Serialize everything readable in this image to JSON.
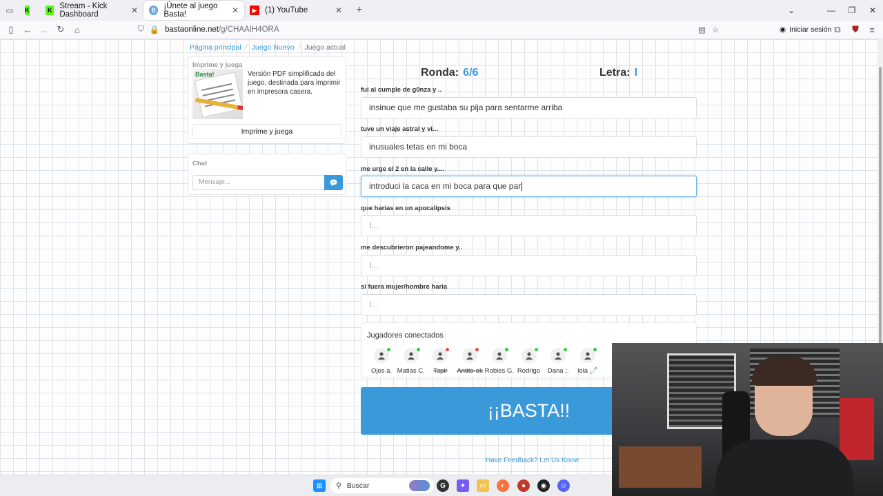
{
  "browser": {
    "tabs": [
      {
        "title": "",
        "favicon": "kick-icon",
        "color": "#53fc18"
      },
      {
        "title": "Stream - Kick Dashboard",
        "favicon": "kick-icon",
        "color": "#53fc18"
      },
      {
        "title": "¡Únete al juego Basta!",
        "favicon": "basta-icon",
        "color": "#6aa5e0"
      },
      {
        "title": "(1) YouTube",
        "favicon": "youtube-icon",
        "color": "#ff0000"
      }
    ],
    "url_host": "bastaonline.net",
    "url_path": "/g/CHAAIH4ORA",
    "signin_label": "Iniciar sesión"
  },
  "breadcrumb": {
    "home": "Página principal",
    "new_game": "Juego Nuevo",
    "current": "Juego actual"
  },
  "print_panel": {
    "title": "Imprime y juega",
    "description": "Versión PDF simplificada del juego, destinada para imprimir en impresora casera.",
    "thumb_brand": "Basta!",
    "button_label": "Imprime y juega"
  },
  "chat": {
    "title": "Chat",
    "placeholder": "Mensaje..."
  },
  "game": {
    "round_label": "Ronda:",
    "round_value": "6/6",
    "letter_label": "Letra:",
    "letter_value": "I"
  },
  "questions": [
    {
      "label": "fui al cumple de g0nza y ..",
      "value": "insinue que me gustaba su pija para sentarme arriba",
      "placeholder": ""
    },
    {
      "label": "tuve un viaje astral y vi...",
      "value": "inusuales tetas en mi boca",
      "placeholder": ""
    },
    {
      "label": "me urge el 2 en la calle y....",
      "value": "introduci la caca en mi boca para que par",
      "placeholder": ""
    },
    {
      "label": "que harias en un apocalipsis",
      "value": "",
      "placeholder": "I..."
    },
    {
      "label": "me descubrieron pajeandome y..",
      "value": "",
      "placeholder": "I..."
    },
    {
      "label": "si fuera mujer/hombre haria",
      "value": "",
      "placeholder": "I..."
    }
  ],
  "players_panel": {
    "title": "Jugadores conectados",
    "players": [
      {
        "name": "Ojos a.",
        "status_color": "#2ecc40",
        "strike": false
      },
      {
        "name": "Matias C.",
        "status_color": "#2ecc40",
        "strike": false
      },
      {
        "name": "Tapir",
        "status_color": "#e74c3c",
        "strike": true
      },
      {
        "name": "Antito-ok",
        "status_color": "#e74c3c",
        "strike": true
      },
      {
        "name": "Robles G.",
        "status_color": "#2ecc40",
        "strike": false
      },
      {
        "name": "Rodrigo",
        "status_color": "#2ecc40",
        "strike": false
      },
      {
        "name": "Dana ;.",
        "status_color": "#2ecc40",
        "strike": false
      },
      {
        "name": "lola 🧷",
        "status_color": "#2ecc40",
        "strike": false
      }
    ]
  },
  "basta_button": "¡¡BASTA!!",
  "feedback_link": "Have Feedback? Let Us Know",
  "taskbar": {
    "search_label": "Buscar"
  },
  "colors": {
    "accent": "#3a9ad9"
  }
}
